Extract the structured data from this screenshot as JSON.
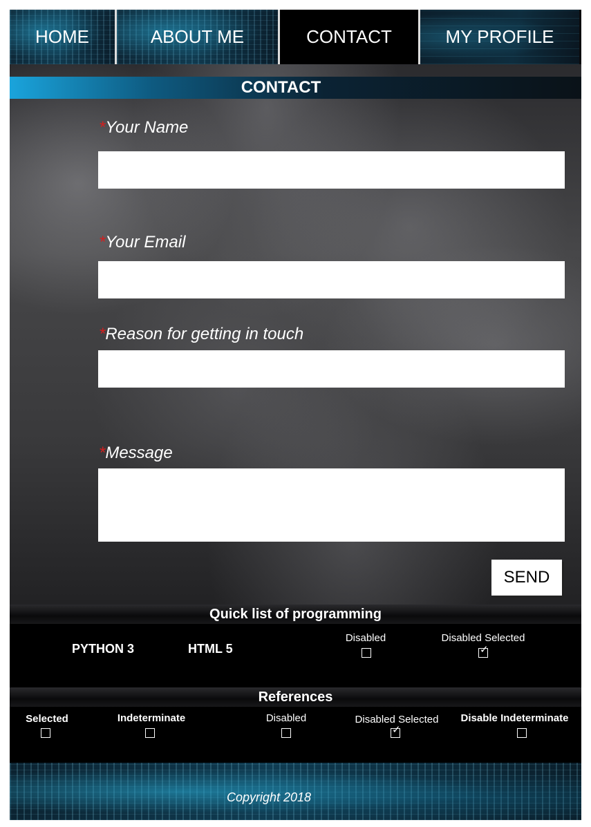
{
  "nav": {
    "home": "HOME",
    "about": "ABOUT ME",
    "contact": "CONTACT",
    "profile": "MY PROFILE"
  },
  "banner": {
    "title": "CONTACT"
  },
  "form": {
    "required_mark": "*",
    "name_label": "Your Name",
    "email_label": "Your Email",
    "reason_label": "Reason for getting in touch",
    "message_label": "Message",
    "name_value": "",
    "email_value": "",
    "reason_value": "",
    "message_value": "",
    "send_label": "SEND"
  },
  "quick_list": {
    "title": "Quick list of programming",
    "languages": [
      "PYTHON 3",
      "HTML 5"
    ],
    "checkboxes": [
      {
        "label": "Disabled",
        "checked": false
      },
      {
        "label": "Disabled Selected",
        "checked": true
      }
    ]
  },
  "references": {
    "title": "References",
    "checkboxes": [
      {
        "label": "Selected",
        "checked": false
      },
      {
        "label": "Indeterminate",
        "checked": false
      },
      {
        "label": "Disabled",
        "checked": false
      },
      {
        "label": "Disabled Selected",
        "checked": true
      },
      {
        "label": "Disable Indeterminate",
        "checked": false
      }
    ]
  },
  "footer": {
    "copyright": "Copyright 2018"
  },
  "colors": {
    "accent": "#1aa4dc",
    "required": "#d21f1f"
  }
}
